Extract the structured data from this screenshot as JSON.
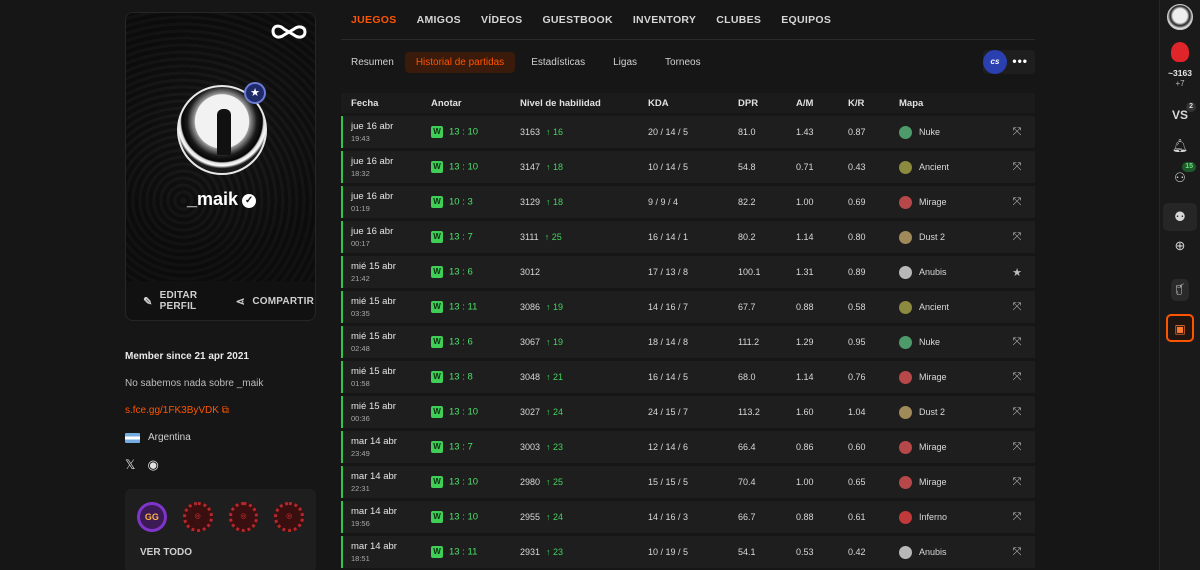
{
  "profile": {
    "nickname": "_maik",
    "actions": {
      "edit": "EDITAR PERFIL",
      "share": "COMPARTIR"
    },
    "member_since": "Member since 21 apr 2021",
    "about": "No sabemos nada sobre _maik",
    "link": "s.fce.gg/1FK3ByVDK",
    "country": "Argentina",
    "see_all": "VER TODO"
  },
  "top_tabs": [
    "JUEGOS",
    "AMIGOS",
    "VÍDEOS",
    "GUESTBOOK",
    "INVENTORY",
    "CLUBES",
    "EQUIPOS"
  ],
  "sub_tabs": [
    "Resumen",
    "Historial de partidas",
    "Estadísticas",
    "Ligas",
    "Torneos"
  ],
  "game_logo": "cs",
  "columns": [
    "Fecha",
    "Anotar",
    "Nivel de habilidad",
    "KDA",
    "DPR",
    "A/M",
    "K/R",
    "Mapa"
  ],
  "matches": [
    {
      "date": "jue 16 abr",
      "time": "19:43",
      "result": "W",
      "score": "13 : 10",
      "elo": "3163",
      "delta": "16",
      "kda": "20 / 14 / 5",
      "dpr": "81.0",
      "am": "1.43",
      "kr": "0.87",
      "map": "Nuke",
      "map_color": "#4d9b6a"
    },
    {
      "date": "jue 16 abr",
      "time": "18:32",
      "result": "W",
      "score": "13 : 10",
      "elo": "3147",
      "delta": "18",
      "kda": "10 / 14 / 5",
      "dpr": "54.8",
      "am": "0.71",
      "kr": "0.43",
      "map": "Ancient",
      "map_color": "#8c8a3e"
    },
    {
      "date": "jue 16 abr",
      "time": "01:19",
      "result": "W",
      "score": "10 : 3",
      "elo": "3129",
      "delta": "18",
      "kda": "9 / 9 / 4",
      "dpr": "82.2",
      "am": "1.00",
      "kr": "0.69",
      "map": "Mirage",
      "map_color": "#b6484a"
    },
    {
      "date": "jue 16 abr",
      "time": "00:17",
      "result": "W",
      "score": "13 : 7",
      "elo": "3111",
      "delta": "25",
      "kda": "16 / 14 / 1",
      "dpr": "80.2",
      "am": "1.14",
      "kr": "0.80",
      "map": "Dust 2",
      "map_color": "#a08a5a"
    },
    {
      "date": "mié 15 abr",
      "time": "21:42",
      "result": "W",
      "score": "13 : 6",
      "elo": "3012",
      "delta": "",
      "kda": "17 / 13 / 8",
      "dpr": "100.1",
      "am": "1.31",
      "kr": "0.89",
      "map": "Anubis",
      "map_color": "#b8b8b8"
    },
    {
      "date": "mié 15 abr",
      "time": "03:35",
      "result": "W",
      "score": "13 : 11",
      "elo": "3086",
      "delta": "19",
      "kda": "14 / 16 / 7",
      "dpr": "67.7",
      "am": "0.88",
      "kr": "0.58",
      "map": "Ancient",
      "map_color": "#8c8a3e"
    },
    {
      "date": "mié 15 abr",
      "time": "02:48",
      "result": "W",
      "score": "13 : 6",
      "elo": "3067",
      "delta": "19",
      "kda": "18 / 14 / 8",
      "dpr": "111.2",
      "am": "1.29",
      "kr": "0.95",
      "map": "Nuke",
      "map_color": "#4d9b6a"
    },
    {
      "date": "mié 15 abr",
      "time": "01:58",
      "result": "W",
      "score": "13 : 8",
      "elo": "3048",
      "delta": "21",
      "kda": "16 / 14 / 5",
      "dpr": "68.0",
      "am": "1.14",
      "kr": "0.76",
      "map": "Mirage",
      "map_color": "#b6484a"
    },
    {
      "date": "mié 15 abr",
      "time": "00:36",
      "result": "W",
      "score": "13 : 10",
      "elo": "3027",
      "delta": "24",
      "kda": "24 / 15 / 7",
      "dpr": "113.2",
      "am": "1.60",
      "kr": "1.04",
      "map": "Dust 2",
      "map_color": "#a08a5a"
    },
    {
      "date": "mar 14 abr",
      "time": "23:49",
      "result": "W",
      "score": "13 : 7",
      "elo": "3003",
      "delta": "23",
      "kda": "12 / 14 / 6",
      "dpr": "66.4",
      "am": "0.86",
      "kr": "0.60",
      "map": "Mirage",
      "map_color": "#b6484a"
    },
    {
      "date": "mar 14 abr",
      "time": "22:31",
      "result": "W",
      "score": "13 : 10",
      "elo": "2980",
      "delta": "25",
      "kda": "15 / 15 / 5",
      "dpr": "70.4",
      "am": "1.00",
      "kr": "0.65",
      "map": "Mirage",
      "map_color": "#b6484a"
    },
    {
      "date": "mar 14 abr",
      "time": "19:56",
      "result": "W",
      "score": "13 : 10",
      "elo": "2955",
      "delta": "24",
      "kda": "14 / 16 / 3",
      "dpr": "66.7",
      "am": "0.88",
      "kr": "0.61",
      "map": "Inferno",
      "map_color": "#c0393b"
    },
    {
      "date": "mar 14 abr",
      "time": "18:51",
      "result": "W",
      "score": "13 : 11",
      "elo": "2931",
      "delta": "23",
      "kda": "10 / 19 / 5",
      "dpr": "54.1",
      "am": "0.53",
      "kr": "0.42",
      "map": "Anubis",
      "map_color": "#b8b8b8"
    }
  ],
  "rail": {
    "elo": "~3163",
    "elo_delta": "+7",
    "vs_label": "VS",
    "vs_count": "2",
    "friends_online": "15"
  }
}
